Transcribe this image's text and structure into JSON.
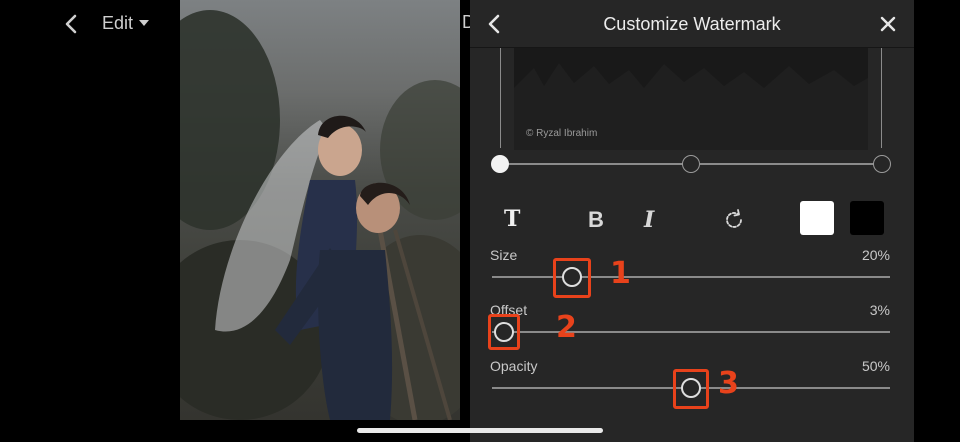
{
  "editor": {
    "menu_label": "Edit",
    "icons": [
      "back-icon",
      "chevron-down-icon",
      "undo-icon"
    ],
    "cut_off_letter": "D"
  },
  "panel": {
    "title": "Customize Watermark",
    "watermark_text": "© Ryzal Ibrahim",
    "anchor_positions": [
      "left",
      "center",
      "right"
    ],
    "selected_anchor": "left",
    "style_buttons": {
      "font": "T",
      "bold": "B",
      "italic": "I"
    },
    "colors": {
      "white_swatch": "#ffffff",
      "black_swatch": "#000000",
      "panel_bg": "#262626",
      "annotation": "#e8421b"
    },
    "sliders": [
      {
        "label": "Size",
        "value": "20%",
        "fraction": 0.2
      },
      {
        "label": "Offset",
        "value": "3%",
        "fraction": 0.03
      },
      {
        "label": "Opacity",
        "value": "50%",
        "fraction": 0.5
      }
    ]
  },
  "annotations": [
    "1",
    "2",
    "3"
  ]
}
